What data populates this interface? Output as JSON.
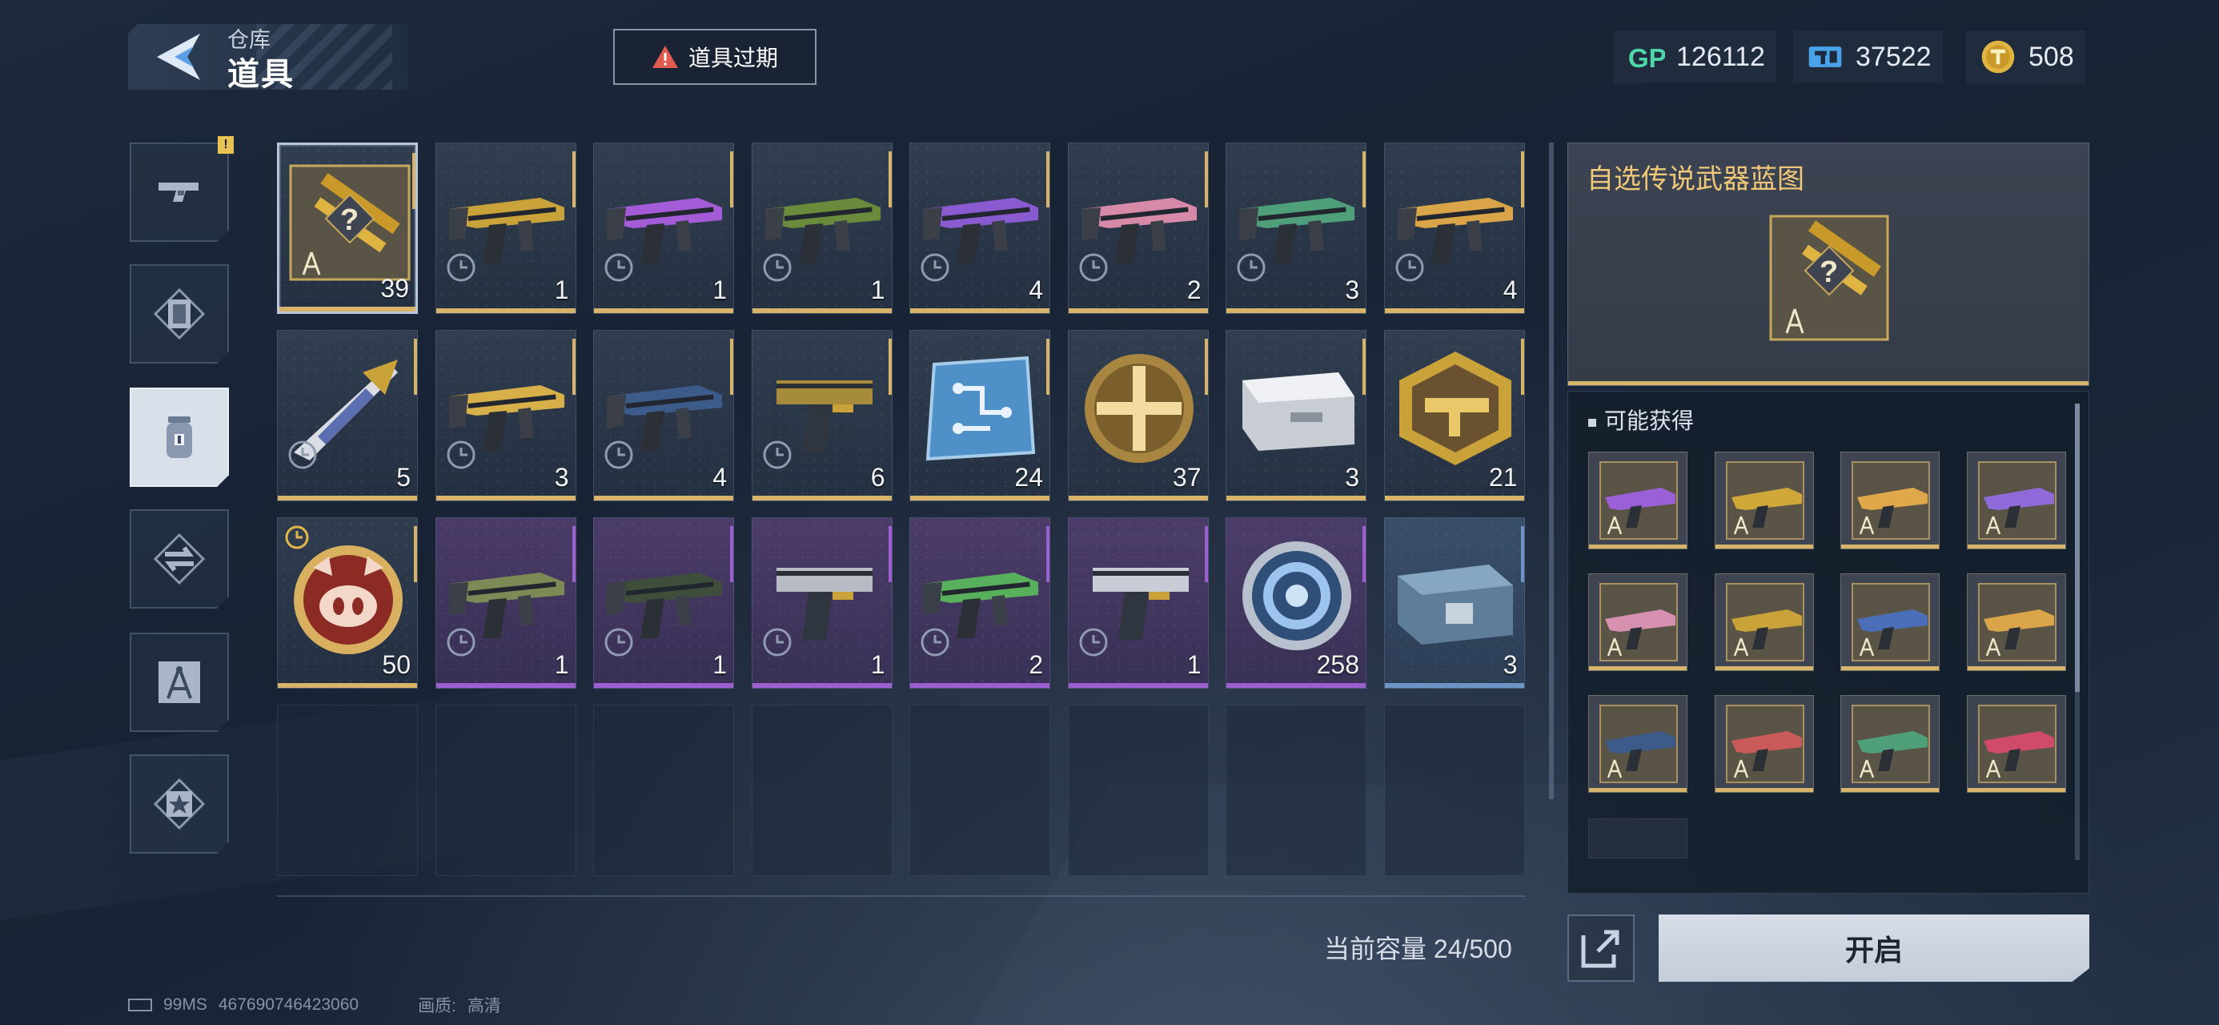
{
  "header": {
    "crumb_parent": "仓库",
    "crumb_title": "道具",
    "expire_label": "道具过期",
    "currencies": [
      {
        "icon": "gp-icon",
        "value": "126112"
      },
      {
        "icon": "ticket-icon",
        "value": "37522"
      },
      {
        "icon": "gold-coin-icon",
        "value": "508"
      }
    ]
  },
  "categories": [
    {
      "name": "weapons",
      "icon": "pistol-icon",
      "active": false,
      "alert": "!"
    },
    {
      "name": "frames",
      "icon": "frame-icon",
      "active": false
    },
    {
      "name": "items",
      "icon": "canister-icon",
      "active": true
    },
    {
      "name": "exchange",
      "icon": "swap-icon",
      "active": false
    },
    {
      "name": "blueprints",
      "icon": "compass-icon",
      "active": false
    },
    {
      "name": "favorites",
      "icon": "star-icon",
      "active": false
    }
  ],
  "items": [
    {
      "count": "39",
      "kind": "blueprint",
      "rarity": "gold",
      "selected": true
    },
    {
      "count": "1",
      "kind": "rifle",
      "rarity": "gold",
      "tint": "#c9a23a"
    },
    {
      "count": "1",
      "kind": "rifle",
      "rarity": "gold",
      "tint": "#a35bd6"
    },
    {
      "count": "1",
      "kind": "rifle",
      "rarity": "gold",
      "tint": "#6a8b3b"
    },
    {
      "count": "4",
      "kind": "rifle",
      "rarity": "gold",
      "tint": "#8a5ad0"
    },
    {
      "count": "2",
      "kind": "rifle",
      "rarity": "gold",
      "tint": "#d68aa8"
    },
    {
      "count": "3",
      "kind": "rifle",
      "rarity": "gold",
      "tint": "#4fa07a"
    },
    {
      "count": "4",
      "kind": "rifle",
      "rarity": "gold",
      "tint": "#d9a548"
    },
    {
      "count": "5",
      "kind": "knife",
      "rarity": "gold",
      "tint": "#5b6fb0"
    },
    {
      "count": "3",
      "kind": "rifle",
      "rarity": "gold",
      "tint": "#d8b04a"
    },
    {
      "count": "4",
      "kind": "rifle",
      "rarity": "gold",
      "tint": "#3c5a8a"
    },
    {
      "count": "6",
      "kind": "pistol",
      "rarity": "gold",
      "tint": "#a68b3a"
    },
    {
      "count": "24",
      "kind": "chip",
      "rarity": "gold"
    },
    {
      "count": "37",
      "kind": "medal",
      "rarity": "gold"
    },
    {
      "count": "3",
      "kind": "block",
      "rarity": "gold"
    },
    {
      "count": "21",
      "kind": "badge",
      "rarity": "gold"
    },
    {
      "count": "50",
      "kind": "pig-coin",
      "rarity": "gold",
      "timed": true
    },
    {
      "count": "1",
      "kind": "rifle",
      "rarity": "purple",
      "tint": "#7d8a55"
    },
    {
      "count": "1",
      "kind": "rifle",
      "rarity": "purple",
      "tint": "#3f4e3a"
    },
    {
      "count": "1",
      "kind": "pistol",
      "rarity": "purple",
      "tint": "#b7bcc4"
    },
    {
      "count": "2",
      "kind": "rifle",
      "rarity": "purple",
      "tint": "#59b05c"
    },
    {
      "count": "1",
      "kind": "pistol",
      "rarity": "purple",
      "tint": "#c7ccd6"
    },
    {
      "count": "258",
      "kind": "ring",
      "rarity": "purple"
    },
    {
      "count": "3",
      "kind": "crate",
      "rarity": "blue"
    }
  ],
  "empty_slots": 8,
  "capacity_label": "当前容量 24/500",
  "detail": {
    "title": "自选传说武器蓝图",
    "possible_label": "可能获得",
    "rewards": [
      {
        "tint": "#9b5fd6"
      },
      {
        "tint": "#d0a83a"
      },
      {
        "tint": "#e0a84a"
      },
      {
        "tint": "#8f6ad8"
      },
      {
        "tint": "#d890b0"
      },
      {
        "tint": "#c9a23a"
      },
      {
        "tint": "#4a6fb8"
      },
      {
        "tint": "#d9a548"
      },
      {
        "tint": "#3c5a8a"
      },
      {
        "tint": "#c85a5a"
      },
      {
        "tint": "#4fa07a"
      },
      {
        "tint": "#d04a6a"
      }
    ],
    "open_label": "开启"
  },
  "footer": {
    "ping": "99MS",
    "uid": "467690746423060",
    "quality_label": "画质:",
    "quality_value": "高清"
  },
  "colors": {
    "gold": "#d7b46a",
    "purple": "#9b5fd0",
    "blue": "#6f95c8",
    "title_gold": "#f0c878"
  }
}
